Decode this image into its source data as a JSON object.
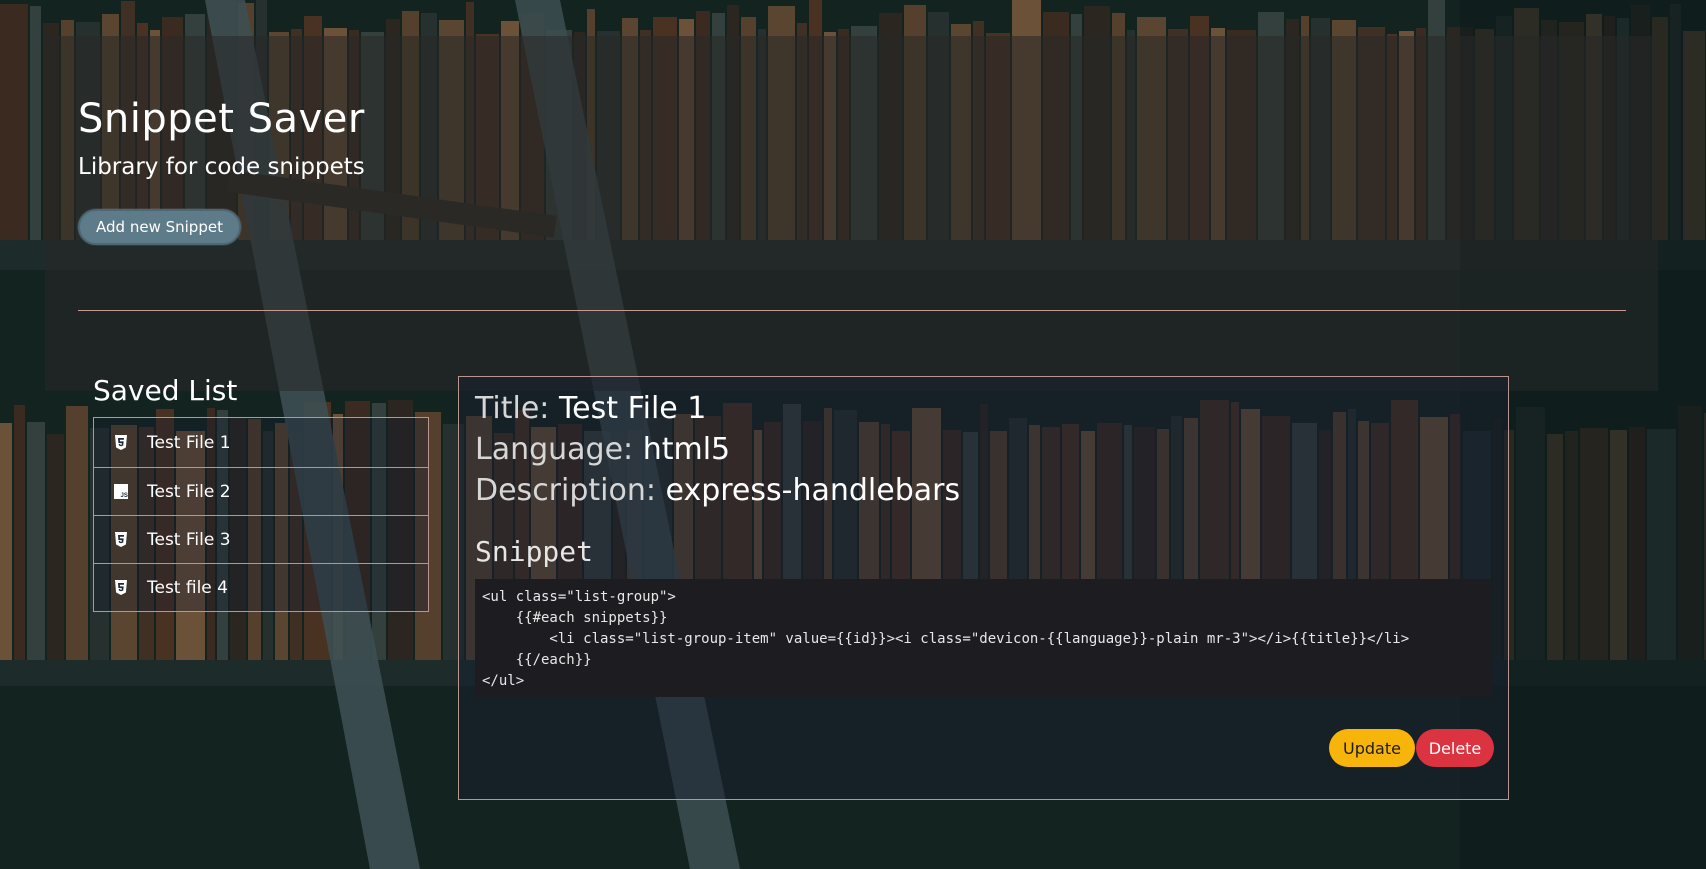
{
  "header": {
    "title": "Snippet Saver",
    "subtitle": "Library for code snippets",
    "add_button_label": "Add new Snippet"
  },
  "saved_list": {
    "title": "Saved List",
    "items": [
      {
        "label": "Test File 1",
        "icon": "html5-icon"
      },
      {
        "label": "Test File 2",
        "icon": "javascript-icon"
      },
      {
        "label": "Test File 3",
        "icon": "html5-icon"
      },
      {
        "label": "Test file 4",
        "icon": "html5-icon"
      }
    ]
  },
  "detail": {
    "title_label": "Title:",
    "title_value": "Test File 1",
    "language_label": "Language:",
    "language_value": "html5",
    "description_label": "Description:",
    "description_value": "express-handlebars",
    "snippet_heading": "Snippet",
    "code": "<ul class=\"list-group\">\n    {{#each snippets}}\n        <li class=\"list-group-item\" value={{id}}><i class=\"devicon-{{language}}-plain mr-3\"></i>{{title}}</li>\n    {{/each}}\n</ul>",
    "update_label": "Update",
    "delete_label": "Delete"
  },
  "colors": {
    "add_button": "#5e7b8a",
    "update_button": "#f7b40a",
    "delete_button": "#dc3340",
    "border_accent": "#b99590"
  }
}
